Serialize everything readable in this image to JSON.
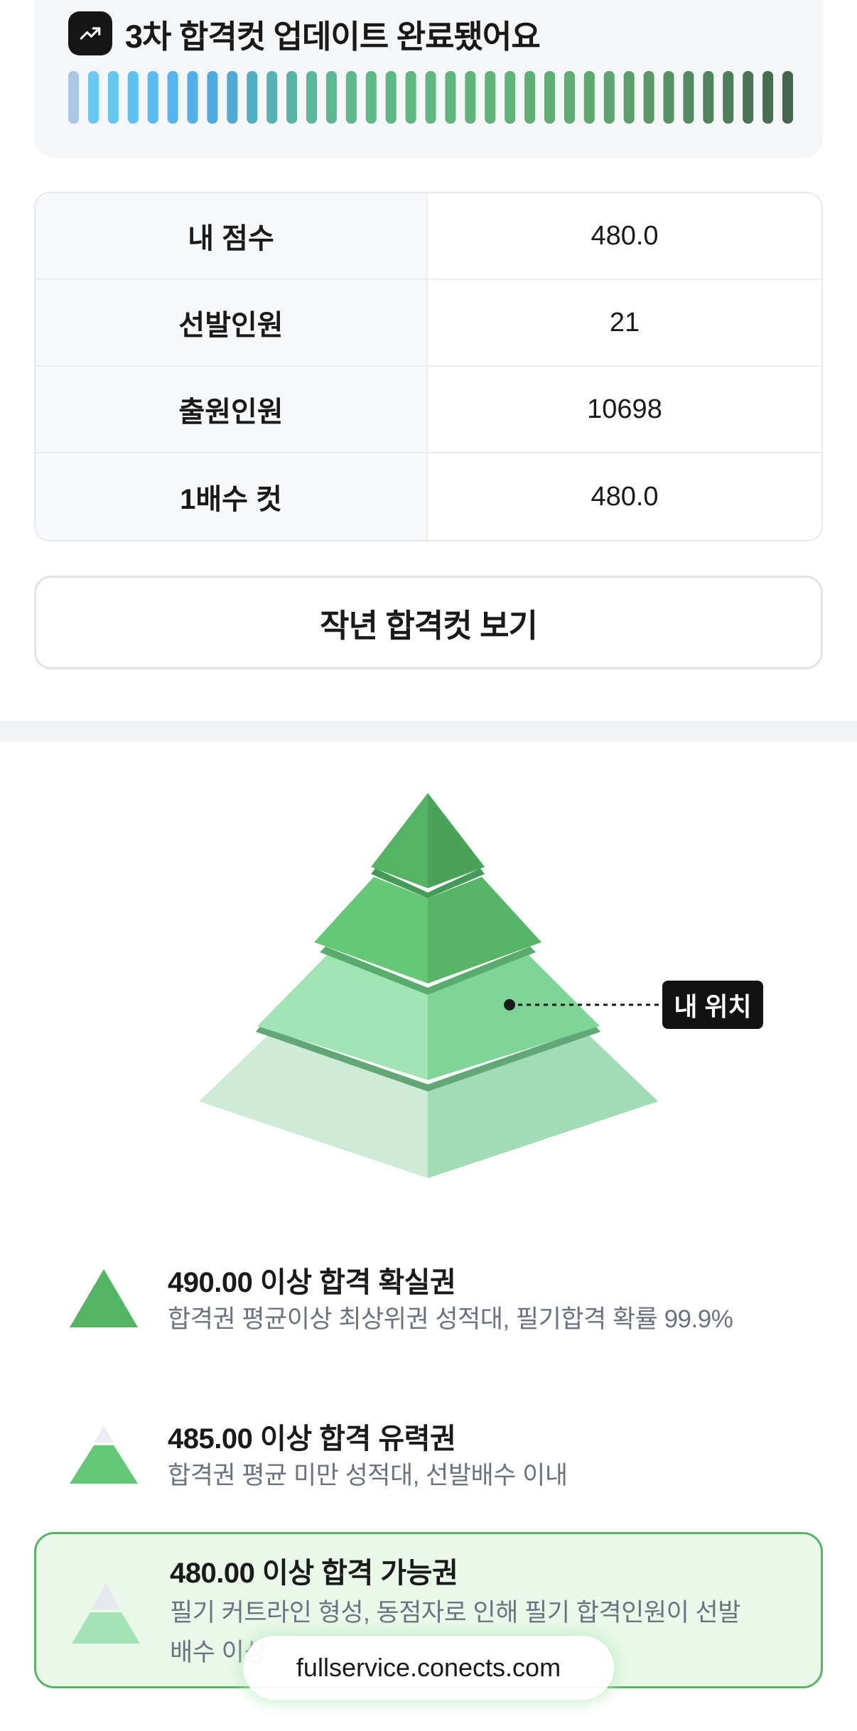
{
  "update": {
    "icon": "trending-up-icon",
    "title": "3차 합격컷 업데이트 완료됐어요",
    "bar_colors": [
      "#aac7e6",
      "#69c9f2",
      "#62c7f3",
      "#5cc2f3",
      "#58bcf2",
      "#55b5ee",
      "#52aee8",
      "#4fa9e4",
      "#4eaad3",
      "#50afc0",
      "#52b3b2",
      "#55b6a6",
      "#58b89c",
      "#5bb993",
      "#5cb98c",
      "#5db987",
      "#5eb883",
      "#5eb780",
      "#5fb67e",
      "#5fb57c",
      "#60b47a",
      "#60b378",
      "#60b277",
      "#60b075",
      "#60ae74",
      "#5fac72",
      "#5ea870",
      "#5da46e",
      "#5b9f6b",
      "#599968",
      "#569264",
      "#548b61",
      "#51855e",
      "#4e7d5a",
      "#4b7556",
      "#486e52",
      "#45664e"
    ]
  },
  "info_table": [
    {
      "label": "내 점수",
      "value": "480.0"
    },
    {
      "label": "선발인원",
      "value": "21"
    },
    {
      "label": "출원인원",
      "value": "10698"
    },
    {
      "label": "1배수 컷",
      "value": "480.0"
    }
  ],
  "last_year_button": "작년 합격컷 보기",
  "pyramid": {
    "my_position_label": "내 위치",
    "colors": {
      "top": "#52b464",
      "second": "#62c875",
      "third": "#9fe3b3",
      "base": "#cbebd6"
    }
  },
  "tiers": [
    {
      "title": "490.00 이상 합격 확실권",
      "desc": "합격권 평균이상 최상위권 성적대, 필기합격 확률 99.9%",
      "desc2": ""
    },
    {
      "title": "485.00 이상 합격 유력권",
      "desc": "합격권 평균 미만 성적대, 선발배수 이내",
      "desc2": ""
    },
    {
      "title": "480.00 이상 합격 가능권",
      "desc": "필기 커트라인 형성, 동점자로 인해 필기 합격인원이 선발",
      "desc2": "배수 이상"
    }
  ],
  "url": "fullservice.conects.com",
  "accent": "#56b462"
}
